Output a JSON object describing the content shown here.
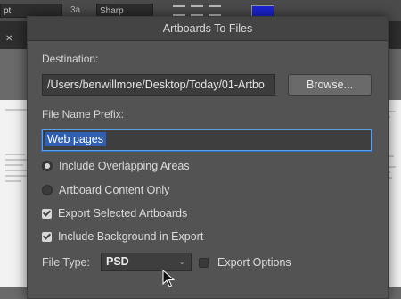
{
  "background": {
    "toolbar": {
      "field_pt": "pt",
      "field_aa": "3a",
      "field_sharp": "Sharp"
    }
  },
  "dialog": {
    "title": "Artboards To Files",
    "destination_label": "Destination:",
    "destination_value": "/Users/benwillmore/Desktop/Today/01-Artbo",
    "browse_label": "Browse...",
    "prefix_label": "File Name Prefix:",
    "prefix_value": "Web pages",
    "options": [
      {
        "label": "Include Overlapping Areas",
        "kind": "radio",
        "checked": true
      },
      {
        "label": "Artboard Content Only",
        "kind": "radio",
        "checked": false
      },
      {
        "label": "Export Selected Artboards",
        "kind": "checkbox",
        "checked": true
      },
      {
        "label": "Include Background in Export",
        "kind": "checkbox",
        "checked": true
      }
    ],
    "file_type_label": "File Type:",
    "file_type_value": "PSD",
    "export_options_label": "Export Options",
    "export_options_checked": false
  },
  "colors": {
    "dialog_bg": "#535353",
    "selection": "#2f5fb0",
    "focus_ring": "#5da1e8",
    "toolbar_color_swatch": "#1b24d6"
  },
  "icons": [
    "close-icon",
    "align-left-icon",
    "align-center-icon",
    "align-right-icon",
    "caret-down-icon",
    "mouse-cursor-icon"
  ]
}
